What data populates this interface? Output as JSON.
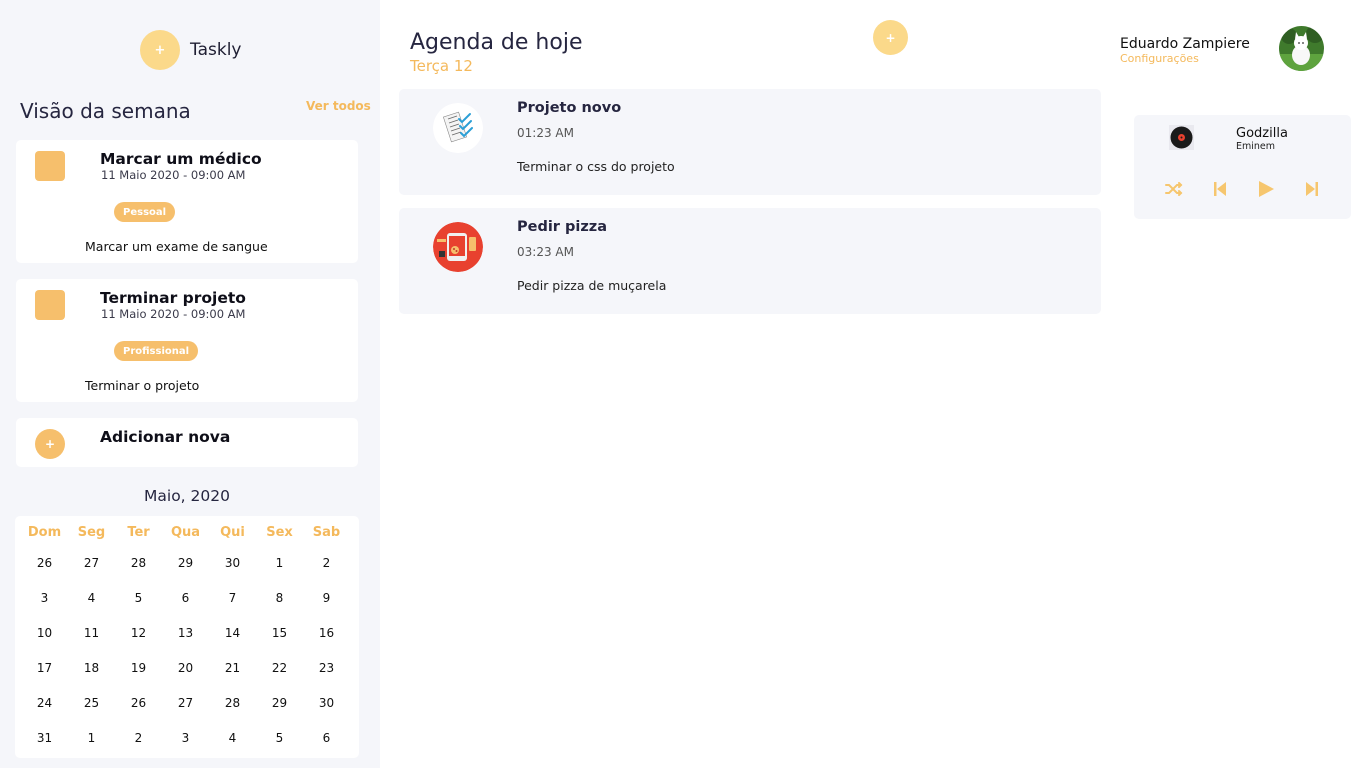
{
  "brand": {
    "icon": "plus-icon",
    "plus": "+",
    "name": "Taskly"
  },
  "week": {
    "title": "Visão da semana",
    "see_all": "Ver todos",
    "tasks": [
      {
        "title": "Marcar um médico",
        "date": "11 Maio 2020 - 09:00 AM",
        "tag": "Pessoal",
        "description": "Marcar um exame de sangue"
      },
      {
        "title": "Terminar projeto",
        "date": "11 Maio 2020 - 09:00 AM",
        "tag": "Profissional",
        "description": "Terminar o projeto"
      }
    ],
    "add": {
      "plus": "+",
      "label": "Adicionar nova"
    }
  },
  "calendar": {
    "title": "Maio, 2020",
    "weekdays": [
      "Dom",
      "Seg",
      "Ter",
      "Qua",
      "Qui",
      "Sex",
      "Sab"
    ],
    "weeks": [
      [
        "26",
        "27",
        "28",
        "29",
        "30",
        "1",
        "2"
      ],
      [
        "3",
        "4",
        "5",
        "6",
        "7",
        "8",
        "9"
      ],
      [
        "10",
        "11",
        "12",
        "13",
        "14",
        "15",
        "16"
      ],
      [
        "17",
        "18",
        "19",
        "20",
        "21",
        "22",
        "23"
      ],
      [
        "24",
        "25",
        "26",
        "27",
        "28",
        "29",
        "30"
      ],
      [
        "31",
        "1",
        "2",
        "3",
        "4",
        "5",
        "6"
      ]
    ]
  },
  "agenda": {
    "title": "Agenda de hoje",
    "subtitle": "Terça 12",
    "add_plus": "+",
    "items": [
      {
        "icon": "checklist-icon",
        "title": "Projeto novo",
        "time": "01:23 AM",
        "description": "Terminar o css do projeto"
      },
      {
        "icon": "pizza-icon",
        "title": "Pedir pizza",
        "time": "03:23 AM",
        "description": "Pedir pizza de muçarela"
      }
    ]
  },
  "user": {
    "name": "Eduardo Zampiere",
    "settings": "Configurações",
    "avatar_icon": "avatar-cat-photo"
  },
  "player": {
    "song": "Godzilla",
    "artist": "Eminem",
    "controls": [
      "shuffle-icon",
      "previous-icon",
      "play-icon",
      "next-icon"
    ]
  },
  "colors": {
    "accent": "#f4b95c",
    "accent_light": "#fbd98a",
    "panel": "#f5f6fa",
    "text": "#262640"
  }
}
